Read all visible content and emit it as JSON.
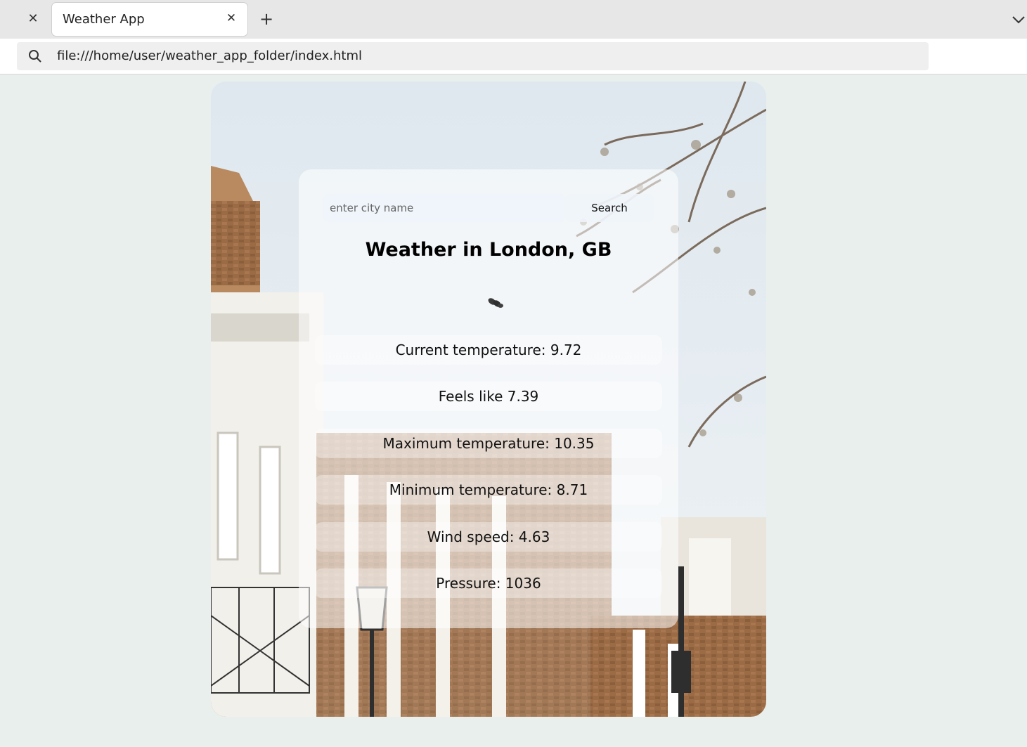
{
  "browser": {
    "tab_title": "Weather App",
    "url": "file:///home/user/weather_app_folder/index.html"
  },
  "search": {
    "placeholder": "enter city name",
    "button_label": "Search"
  },
  "weather": {
    "title": "Weather in London, GB",
    "icon": "broken-clouds-icon",
    "stats": [
      "Current temperature: 9.72",
      "Feels like 7.39",
      "Maximum temperature: 10.35",
      "Minimum temperature: 8.71",
      "Wind speed: 4.63",
      "Pressure: 1036"
    ]
  },
  "colors": {
    "page_background": "#e8efec",
    "sky": "#e4edf3",
    "brick": "#9a6b45",
    "facade": "#f2f0ea"
  }
}
